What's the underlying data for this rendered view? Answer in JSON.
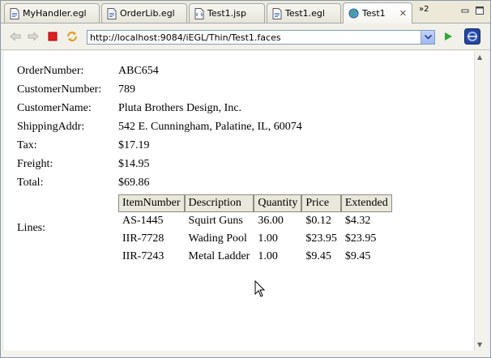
{
  "tabs": [
    {
      "label": "MyHandler.egl",
      "icon": "egl-file-icon"
    },
    {
      "label": "OrderLib.egl",
      "icon": "egl-file-icon"
    },
    {
      "label": "Test1.jsp",
      "icon": "jsp-file-icon"
    },
    {
      "label": "Test1.egl",
      "icon": "egl-file-icon"
    },
    {
      "label": "Test1",
      "icon": "web-browser-icon",
      "active": true
    }
  ],
  "overflow": {
    "label": "»2"
  },
  "toolbar": {
    "url": "http://localhost:9084/iEGL/Thin/Test1.faces"
  },
  "fields": [
    {
      "label": "OrderNumber:",
      "value": "ABC654"
    },
    {
      "label": "CustomerNumber:",
      "value": "789"
    },
    {
      "label": "CustomerName:",
      "value": "Pluta Brothers Design, Inc."
    },
    {
      "label": "ShippingAddr:",
      "value": "542 E. Cunningham, Palatine, IL, 60074"
    },
    {
      "label": "Tax:",
      "value": "$17.19"
    },
    {
      "label": "Freight:",
      "value": "$14.95"
    },
    {
      "label": "Total:",
      "value": "$69.86"
    }
  ],
  "lines": {
    "label": "Lines:",
    "columns": [
      "ItemNumber",
      "Description",
      "Quantity",
      "Price",
      "Extended"
    ],
    "rows": [
      [
        "AS-1445",
        "Squirt Guns",
        "36.00",
        "$0.12",
        "$4.32"
      ],
      [
        "IIR-7728",
        "Wading Pool",
        "1.00",
        "$23.95",
        "$23.95"
      ],
      [
        "IIR-7243",
        "Metal Ladder",
        "1.00",
        "$9.45",
        "$9.45"
      ]
    ]
  },
  "colors": {
    "stop_button": "#e02020",
    "go_button": "#2fa82f",
    "header_cell": "#eae8dc"
  }
}
